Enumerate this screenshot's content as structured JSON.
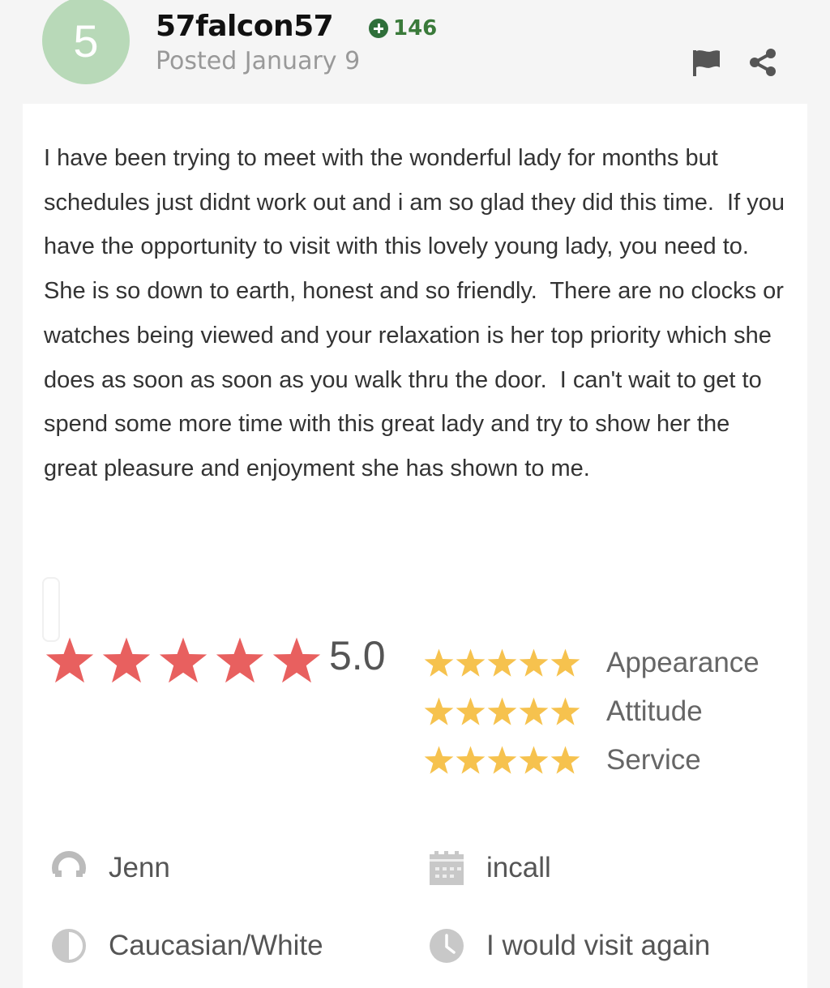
{
  "header": {
    "rank": "5",
    "username": "57falcon57",
    "points": "146",
    "posted": "Posted January 9"
  },
  "review": {
    "text": "I have been trying to meet with the wonderful lady for months but schedules just didnt work out and i am so glad they did this time.  If you have the opportunity to visit with this lovely young lady, you need to.  She is so down to earth, honest and so friendly.  There are no clocks or watches being viewed and your relaxation is her top priority which she does as soon as soon as you walk thru the door.  I can't wait to get to spend some more time with this great lady and try to show her the great pleasure and enjoyment she has shown to me."
  },
  "rating": {
    "overall": "5.0",
    "overall_stars": 5,
    "categories": [
      {
        "label": "Appearance",
        "stars": 5
      },
      {
        "label": "Attitude",
        "stars": 5
      },
      {
        "label": "Service",
        "stars": 5
      }
    ]
  },
  "details": {
    "provider": "Jenn",
    "location_type": "incall",
    "ethnicity": "Caucasian/White",
    "revisit": "I would visit again"
  },
  "colors": {
    "overall_star": "#e8605f",
    "category_star": "#f6c24e",
    "avatar_bg": "#b8d9b8",
    "points_green": "#2f6f3a"
  },
  "icons": {
    "flag": "flag-icon",
    "share": "share-icon",
    "provider": "person-icon",
    "location": "calendar-icon",
    "ethnicity": "half-circle-icon",
    "revisit": "clock-icon"
  }
}
